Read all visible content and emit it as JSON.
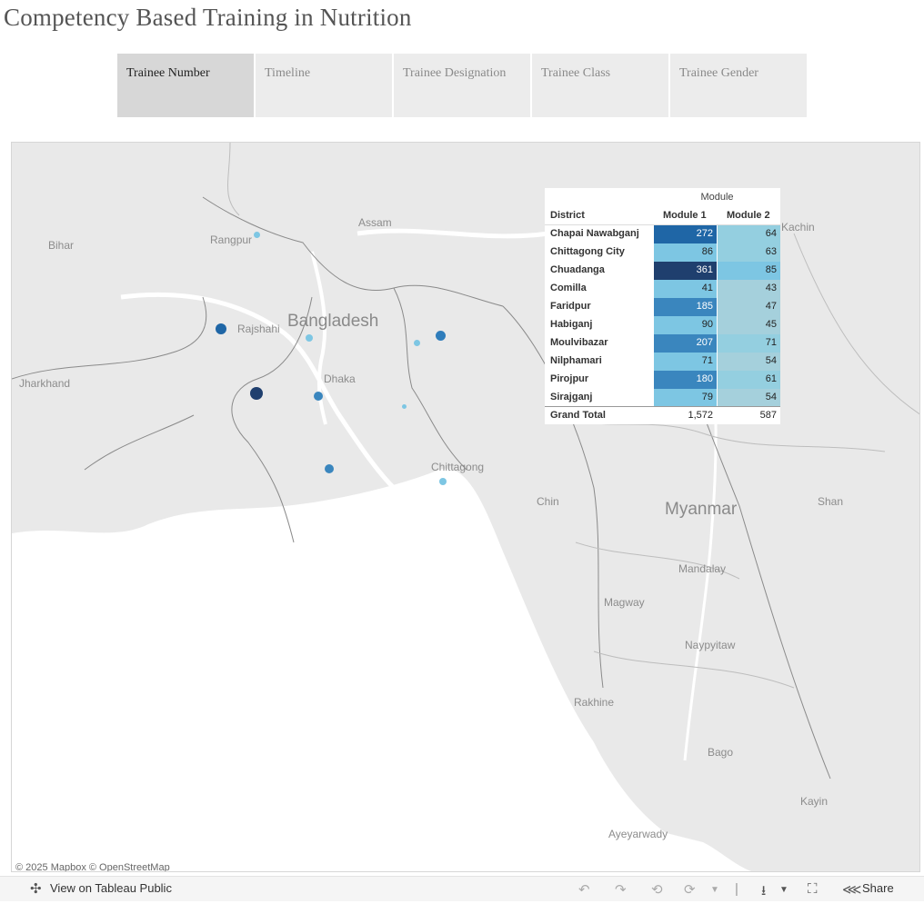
{
  "title": "Competency Based Training in Nutrition",
  "tabs": [
    {
      "label": "Trainee Number",
      "active": true
    },
    {
      "label": "Timeline",
      "active": false
    },
    {
      "label": "Trainee Designation",
      "active": false
    },
    {
      "label": "Trainee Class",
      "active": false
    },
    {
      "label": "Trainee Gender",
      "active": false
    }
  ],
  "map": {
    "labels": {
      "bihar": "Bihar",
      "rangpur": "Rangpur",
      "assam": "Assam",
      "kachin": "Kachin",
      "rajshahi": "Rajshahi",
      "bangladesh": "Bangladesh",
      "jharkhand": "Jharkhand",
      "dhaka": "Dhaka",
      "chittagong": "Chittagong",
      "chin": "Chin",
      "myanmar": "Myanmar",
      "shan": "Shan",
      "mandalay": "Mandalay",
      "magway": "Magway",
      "naypyitaw": "Naypyitaw",
      "rakhine": "Rakhine",
      "bago": "Bago",
      "kayin": "Kayin",
      "ayeyarwady": "Ayeyarwady"
    },
    "attribution": "© 2025 Mapbox  © OpenStreetMap",
    "colors": {
      "darkest": "#1f3f6e",
      "dark": "#1f66a6",
      "mid": "#3a86be",
      "light": "#7dc6e3",
      "palest": "#a5d0dc"
    }
  },
  "table": {
    "header_module": "Module",
    "header_district": "District",
    "header_m1": "Module 1",
    "header_m2": "Module 2",
    "rows": [
      {
        "district": "Chapai Nawabganj",
        "m1": "272",
        "m2": "64"
      },
      {
        "district": "Chittagong City",
        "m1": "86",
        "m2": "63"
      },
      {
        "district": "Chuadanga",
        "m1": "361",
        "m2": "85"
      },
      {
        "district": "Comilla",
        "m1": "41",
        "m2": "43"
      },
      {
        "district": "Faridpur",
        "m1": "185",
        "m2": "47"
      },
      {
        "district": "Habiganj",
        "m1": "90",
        "m2": "45"
      },
      {
        "district": "Moulvibazar",
        "m1": "207",
        "m2": "71"
      },
      {
        "district": "Nilphamari",
        "m1": "71",
        "m2": "54"
      },
      {
        "district": "Pirojpur",
        "m1": "180",
        "m2": "61"
      },
      {
        "district": "Sirajganj",
        "m1": "79",
        "m2": "54"
      }
    ],
    "grand_label": "Grand Total",
    "grand_m1": "1,572",
    "grand_m2": "587"
  },
  "toolbar": {
    "view_label": "View on Tableau Public",
    "share_label": "Share"
  }
}
